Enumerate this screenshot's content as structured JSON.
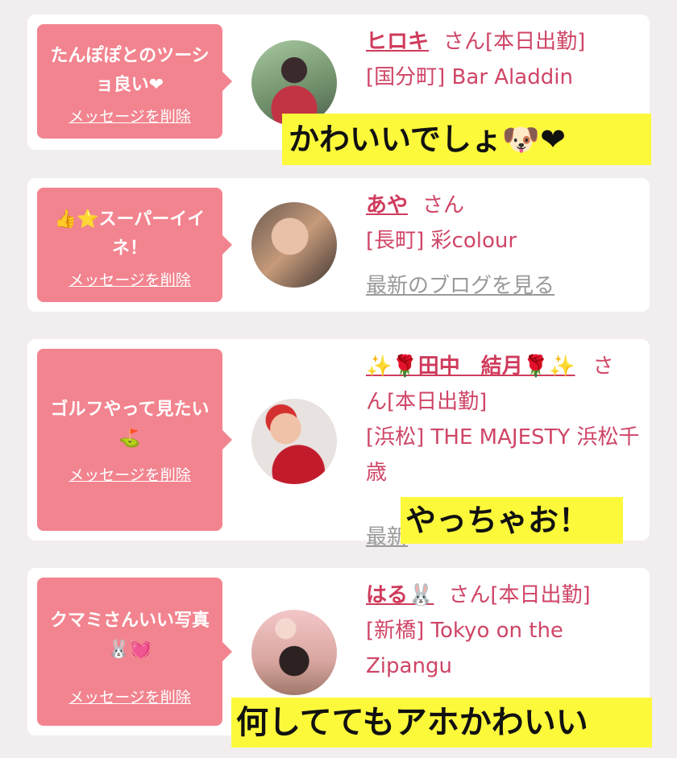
{
  "messages": [
    {
      "message_text": "たんぽぽとのツーショ良い❤",
      "delete_label": "メッセージを削除",
      "name": "ヒロキ",
      "honorific": "さん",
      "status": "[本日出勤]",
      "shop": "[国分町] Bar Aladdin",
      "blog_link": "",
      "caption": "かわいいでしょ🐶❤"
    },
    {
      "message_text": "👍⭐スーパーイイネ！",
      "delete_label": "メッセージを削除",
      "name": "あや",
      "honorific": "さん",
      "status": "",
      "shop": "[長町] 彩colour",
      "blog_link": "最新のブログを見る",
      "caption": ""
    },
    {
      "message_text": "ゴルフやって見たい⛳",
      "delete_label": "メッセージを削除",
      "name": "✨🌹田中　結月🌹✨",
      "honorific": "さ",
      "honorific_cont": "ん[本日出勤]",
      "shop": "[浜松] THE MAJESTY 浜松千歳",
      "blog_link": "最新",
      "caption": "やっちゃお！"
    },
    {
      "message_text": "クマミさんいい写真🐰💓",
      "delete_label": "メッセージを削除",
      "name": "はる🐰",
      "honorific": "さん",
      "status": "[本日出勤]",
      "shop": "[新橋] Tokyo on the Zipangu",
      "blog_link": "",
      "caption": "何しててもアホかわいい"
    }
  ],
  "colors": {
    "bubble": "#f2848f",
    "accent": "#cf3b5c",
    "caption_bg": "#fcf93b"
  }
}
